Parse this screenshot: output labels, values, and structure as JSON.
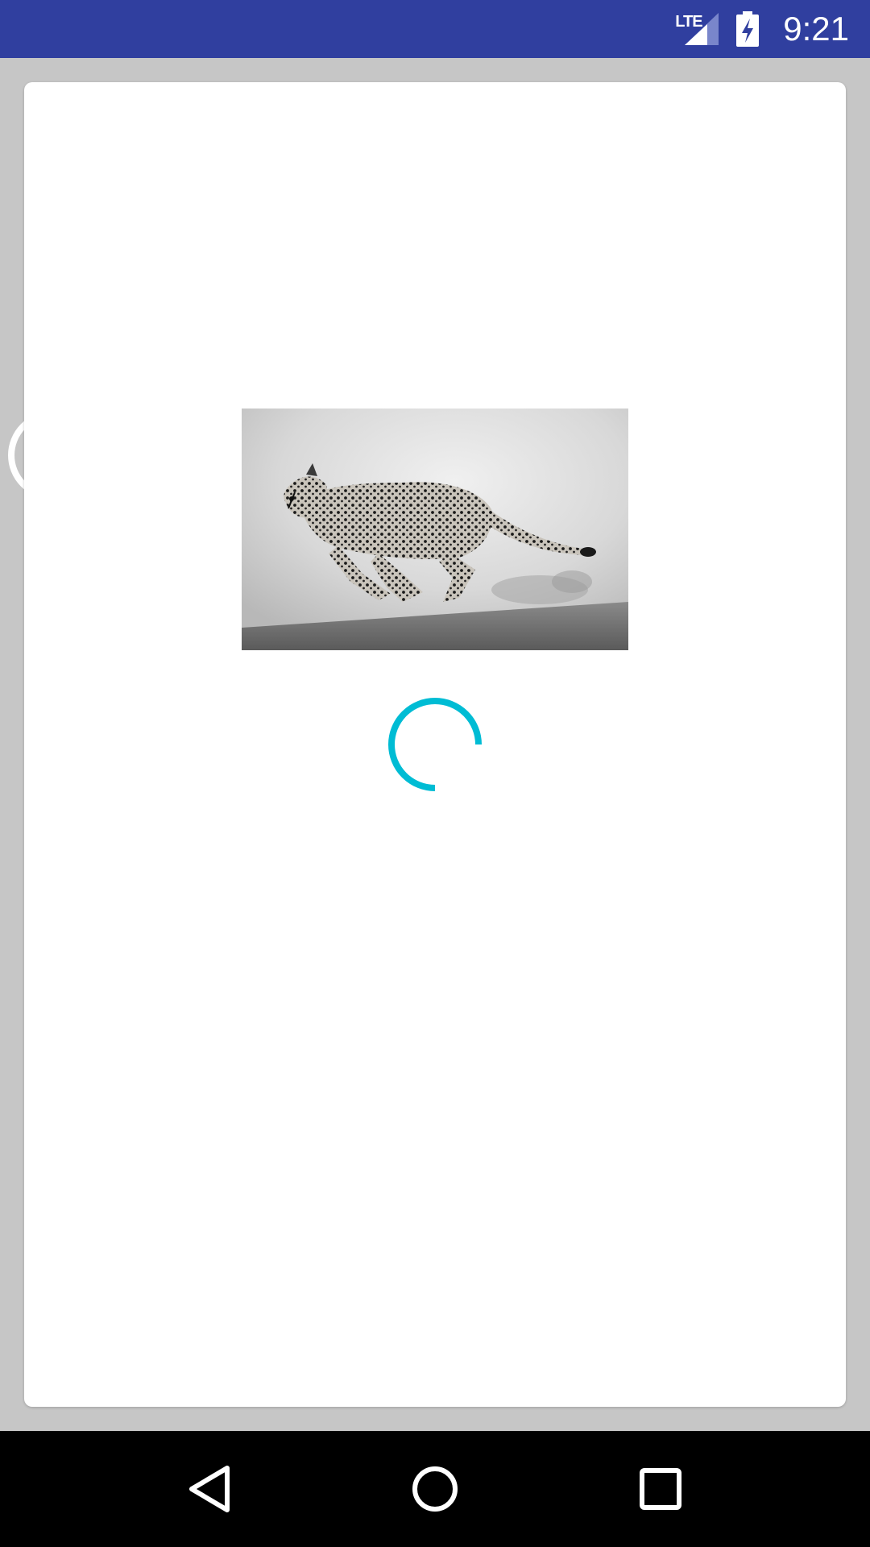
{
  "status_bar": {
    "network_label": "LTE",
    "time": "9:21",
    "background": "#303f9f"
  },
  "content": {
    "image_subject": "cheetah-running",
    "spinner_color": "#00bcd4"
  },
  "nav_bar": {
    "icons": [
      "back-icon",
      "home-icon",
      "recents-icon"
    ]
  }
}
